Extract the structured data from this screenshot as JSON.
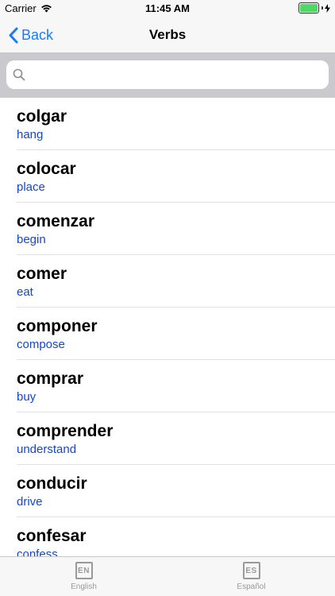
{
  "status_bar": {
    "carrier": "Carrier",
    "time": "11:45 AM",
    "battery_level": 1.0
  },
  "nav": {
    "back_label": "Back",
    "title": "Verbs"
  },
  "search": {
    "value": "",
    "placeholder": ""
  },
  "verbs": [
    {
      "word": "colgar",
      "translation": "hang"
    },
    {
      "word": "colocar",
      "translation": "place"
    },
    {
      "word": "comenzar",
      "translation": "begin"
    },
    {
      "word": "comer",
      "translation": "eat"
    },
    {
      "word": "componer",
      "translation": "compose"
    },
    {
      "word": "comprar",
      "translation": "buy"
    },
    {
      "word": "comprender",
      "translation": "understand"
    },
    {
      "word": "conducir",
      "translation": "drive"
    },
    {
      "word": "confesar",
      "translation": "confess"
    }
  ],
  "tabs": [
    {
      "icon_text": "EN",
      "label": "English"
    },
    {
      "icon_text": "ES",
      "label": "Español"
    }
  ],
  "colors": {
    "accent": "#1a7bff",
    "translation": "#1447c9",
    "battery": "#4cd964",
    "tab_inactive": "#9a9a9a"
  },
  "icons": {
    "wifi": "wifi-icon",
    "back": "chevron-left-icon",
    "search": "search-icon",
    "charging": "bolt-icon"
  }
}
